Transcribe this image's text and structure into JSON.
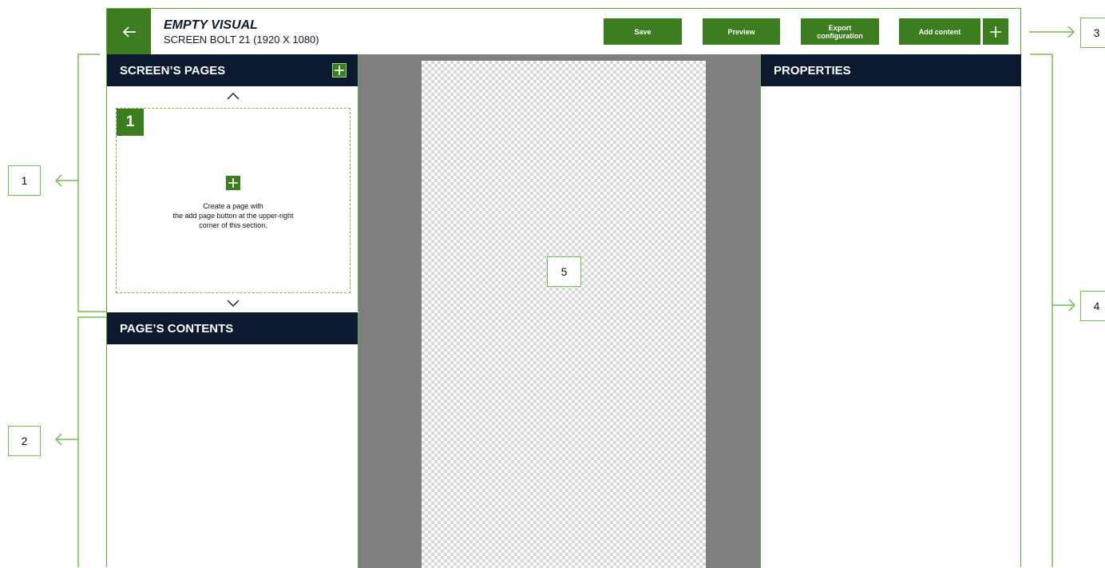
{
  "header": {
    "title": "EMPTY VISUAL",
    "subtitle": "SCREEN BOLT 21 (1920 X 1080)",
    "back_icon": "arrow-left-icon"
  },
  "toolbar": {
    "save_label": "Save",
    "preview_label": "Preview",
    "export_label": "Export\nconfiguration",
    "add_content_label": "Add content",
    "add_content_icon": "plus-icon"
  },
  "pages_panel": {
    "title": "SCREEN’S PAGES",
    "add_icon": "plus-icon",
    "page_number": "1",
    "empty_message": "Create a page with\nthe add page button at the upper-right\ncorner of this section."
  },
  "contents_panel": {
    "title": "PAGE’S CONTENTS"
  },
  "properties_panel": {
    "title": "PROPERTIES"
  },
  "callouts": [
    "1",
    "2",
    "3",
    "4",
    "5"
  ],
  "colors": {
    "accent_green": "#3b7d1f",
    "annotation_green": "#6fbf4a",
    "header_navy": "#0b1a2f",
    "canvas_gray": "#7f7f7f"
  }
}
